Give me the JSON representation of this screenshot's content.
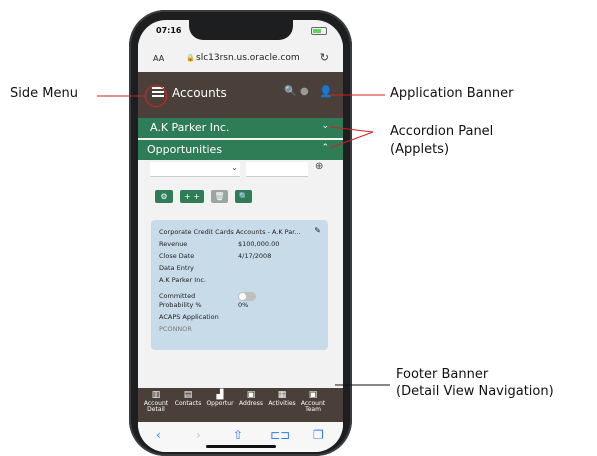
{
  "status": {
    "time": "07:16"
  },
  "browser": {
    "aa": "AA",
    "url": "slc13rsn.us.oracle.com",
    "reload": "↻"
  },
  "banner": {
    "title": "Accounts"
  },
  "accordion": [
    {
      "label": "A.K Parker Inc.",
      "chevron": "⌄"
    },
    {
      "label": "Opportunities",
      "chevron": "⌃"
    }
  ],
  "toolbar": {
    "dropdown": "⌄",
    "go": "⊕"
  },
  "buttons": [
    {
      "label": "⚙"
    },
    {
      "label": "+ +"
    },
    {
      "label": "🗑"
    },
    {
      "label": "🔍"
    }
  ],
  "card": {
    "title": "Corporate Credit Cards Accounts - A.K Par...",
    "rows": [
      {
        "label": "Revenue",
        "value": "$100,000.00"
      },
      {
        "label": "Close Date",
        "value": "4/17/2008"
      },
      {
        "label": "Data Entry",
        "value": ""
      },
      {
        "label": "A.K Parker Inc.",
        "value": ""
      },
      {
        "label": "Committed",
        "value": ""
      },
      {
        "label": "Probability %",
        "value": "0%"
      },
      {
        "label": "ACAPS Application",
        "value": ""
      },
      {
        "label": "PCONNOR",
        "value": ""
      }
    ]
  },
  "footer": [
    {
      "label": "Account Detail"
    },
    {
      "label": "Contacts"
    },
    {
      "label": "Opportur"
    },
    {
      "label": "Address"
    },
    {
      "label": "Activities"
    },
    {
      "label": "Account Team"
    }
  ],
  "callouts": {
    "side_menu": "Side Menu",
    "app_banner": "Application Banner",
    "accordion_1": "Accordion Panel",
    "accordion_2": "(Applets)",
    "footer_1": "Footer Banner",
    "footer_2": "(Detail View Navigation)"
  }
}
